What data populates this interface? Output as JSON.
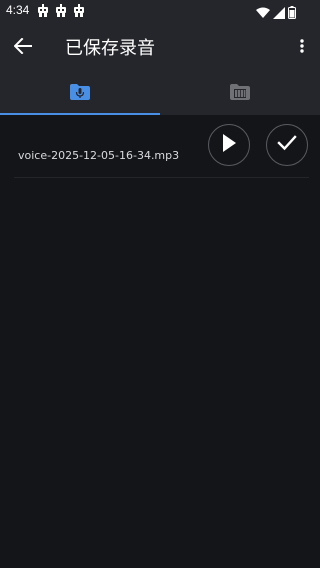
{
  "status_bar": {
    "time": "4:34",
    "notification_icons": [
      "robot-icon",
      "robot-icon",
      "robot-icon"
    ],
    "system_icons": [
      "wifi-icon",
      "signal-icon",
      "battery-icon"
    ]
  },
  "app_bar": {
    "title": "已保存录音",
    "back_icon": "arrow-left-icon",
    "overflow_icon": "more-vertical-icon"
  },
  "tabs": [
    {
      "icon": "folder-mic-icon",
      "selected": true
    },
    {
      "icon": "folder-piano-icon",
      "selected": false
    }
  ],
  "colors": {
    "background": "#141519",
    "bar": "#25262b",
    "accent": "#4a8fe6",
    "inactive_icon": "#6f7176"
  },
  "recordings": [
    {
      "name": "voice-2025-12-05-16-34.mp3",
      "play_icon": "play-icon",
      "select_icon": "check-icon"
    }
  ]
}
